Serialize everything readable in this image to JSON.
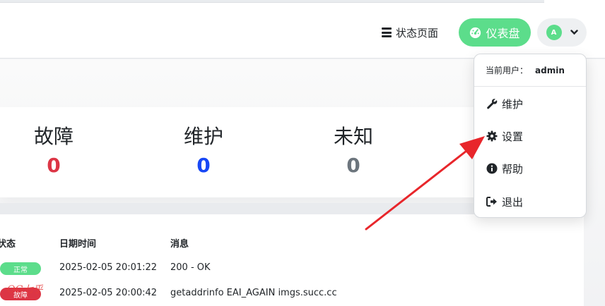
{
  "header": {
    "status_page_label": "状态页面",
    "dashboard_label": "仪表盘",
    "avatar_initial": "A"
  },
  "stats": [
    {
      "label": "故障",
      "value": "0",
      "color": "#dc3545"
    },
    {
      "label": "维护",
      "value": "0",
      "color": "#1747f5"
    },
    {
      "label": "未知",
      "value": "0",
      "color": "#6c757d"
    }
  ],
  "table": {
    "headers": {
      "status": "状态",
      "datetime": "日期时间",
      "message": "消息"
    },
    "rows": [
      {
        "status": "正常",
        "status_color": "#5cdd8b",
        "datetime": "2025-02-05 20:01:22",
        "message": "200 - OK"
      },
      {
        "status": "故障",
        "status_color": "#dc3545",
        "datetime": "2025-02-05 20:00:42",
        "message": "getaddrinfo EAI_AGAIN imgs.succ.cc"
      }
    ]
  },
  "dropdown": {
    "current_user_label": "当前用户：",
    "username": "admin",
    "items": [
      {
        "label": "维护",
        "icon": "wrench-icon"
      },
      {
        "label": "设置",
        "icon": "gear-icon"
      },
      {
        "label": "帮助",
        "icon": "info-circle-icon"
      },
      {
        "label": "退出",
        "icon": "logout-icon"
      }
    ]
  },
  "watermark": "OG七乎",
  "colors": {
    "accent": "#5cdd8b",
    "annotation_arrow": "#e8262b"
  }
}
